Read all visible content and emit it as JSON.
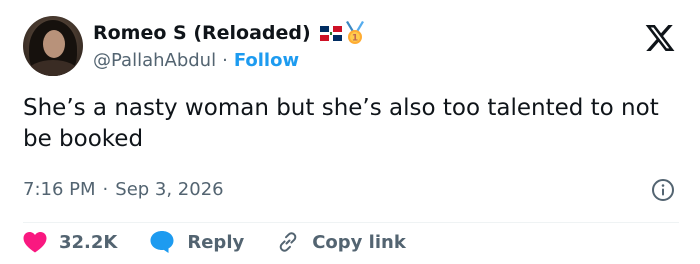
{
  "tweet": {
    "author": {
      "display_name": "Romeo S (Reloaded)",
      "handle": "@PallahAbdul",
      "follow_label": "Follow",
      "separator": "·",
      "badges": [
        "dominican-republic-flag-icon",
        "first-place-medal-icon"
      ]
    },
    "text": "She’s a nasty woman but she’s also too talented to not be booked",
    "time": "7:16 PM",
    "meta_separator": "·",
    "date": "Sep 3, 2026",
    "actions": {
      "likes": "32.2K",
      "reply_label": "Reply",
      "copy_link_label": "Copy link"
    },
    "icons": {
      "brand": "x-logo-icon",
      "info": "info-icon",
      "like": "heart-icon",
      "reply": "reply-bubble-icon",
      "copy": "link-icon"
    },
    "colors": {
      "accent": "#1d9bf0",
      "like": "#f91880",
      "secondary_text": "#536471",
      "primary_text": "#0f1419"
    }
  }
}
